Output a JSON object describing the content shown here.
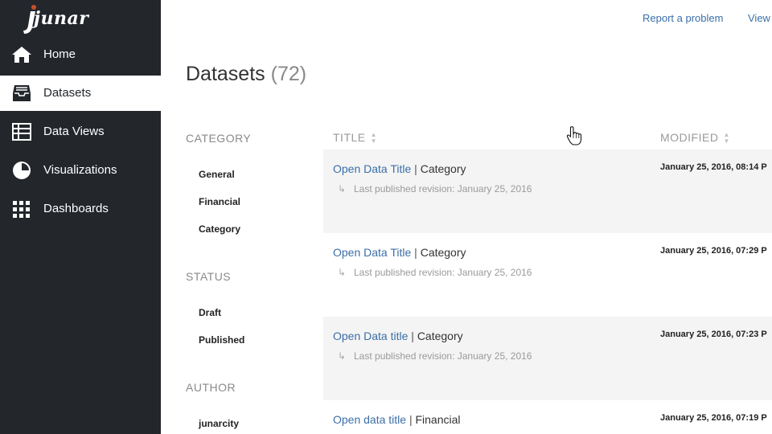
{
  "brand": {
    "name": "junar",
    "accent": "#c8502a"
  },
  "sidebar": {
    "items": [
      {
        "label": "Home",
        "icon": "home-icon",
        "active": false
      },
      {
        "label": "Datasets",
        "icon": "inbox-tray-icon",
        "active": true
      },
      {
        "label": "Data Views",
        "icon": "table-grid-icon",
        "active": false
      },
      {
        "label": "Visualizations",
        "icon": "pie-chart-icon",
        "active": false
      },
      {
        "label": "Dashboards",
        "icon": "dashboard-grid-icon",
        "active": false
      }
    ]
  },
  "toplinks": {
    "report": "Report a problem",
    "view": "View"
  },
  "page": {
    "title": "Datasets",
    "count": "(72)"
  },
  "filters": {
    "category": {
      "heading": "CATEGORY",
      "items": [
        "General",
        "Financial",
        "Category"
      ]
    },
    "status": {
      "heading": "STATUS",
      "items": [
        "Draft",
        "Published"
      ]
    },
    "author": {
      "heading": "AUTHOR",
      "items": [
        "junarcity"
      ]
    }
  },
  "table": {
    "headers": {
      "title": "TITLE",
      "modified": "MODIFIED"
    },
    "rows": [
      {
        "title": "Open Data Title",
        "separator": "|",
        "category": "Category",
        "revision": "Last published revision: January 25, 2016",
        "modified": "January 25, 2016, 08:14 P"
      },
      {
        "title": "Open Data Title",
        "separator": "|",
        "category": "Category",
        "revision": "Last published revision: January 25, 2016",
        "modified": "January 25, 2016, 07:29 P"
      },
      {
        "title": "Open Data title",
        "separator": "|",
        "category": "Category",
        "revision": "Last published revision: January 25, 2016",
        "modified": "January 25, 2016, 07:23 P"
      },
      {
        "title": "Open data title",
        "separator": "|",
        "category": "Financial",
        "revision": "",
        "modified": "January 25, 2016, 07:19 P"
      }
    ]
  }
}
